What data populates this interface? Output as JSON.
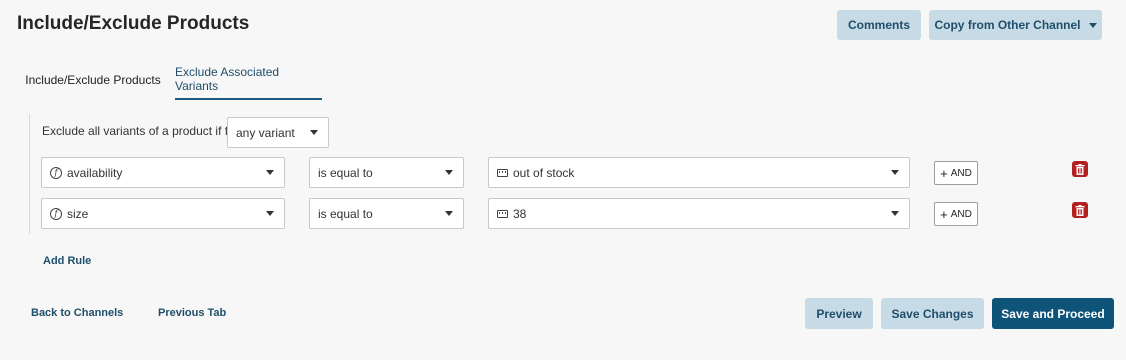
{
  "header": {
    "title": "Include/Exclude Products",
    "comments_label": "Comments",
    "copy_label": "Copy from Other Channel"
  },
  "tabs": [
    {
      "label": "Include/Exclude Products",
      "active": false
    },
    {
      "label": "Exclude Associated Variants",
      "active": true
    }
  ],
  "rule_header": {
    "label": "Exclude all variants of a product if for",
    "scope_value": "any variant"
  },
  "rules": [
    {
      "field": "availability",
      "operator": "is equal to",
      "value": "out of stock",
      "and_label": "AND"
    },
    {
      "field": "size",
      "operator": "is equal to",
      "value": "38",
      "and_label": "AND"
    }
  ],
  "add_rule_label": "Add Rule",
  "footer": {
    "back_label": "Back to Channels",
    "previous_label": "Previous Tab",
    "preview_label": "Preview",
    "save_label": "Save Changes",
    "proceed_label": "Save and Proceed"
  },
  "colors": {
    "accent_dark": "#0d5478",
    "accent_light": "#c6dbe6",
    "delete_red": "#b21f1f"
  },
  "icons": {
    "field_icon": "function-icon",
    "value_icon": "keyboard-icon",
    "delete_icon": "trash-icon"
  }
}
